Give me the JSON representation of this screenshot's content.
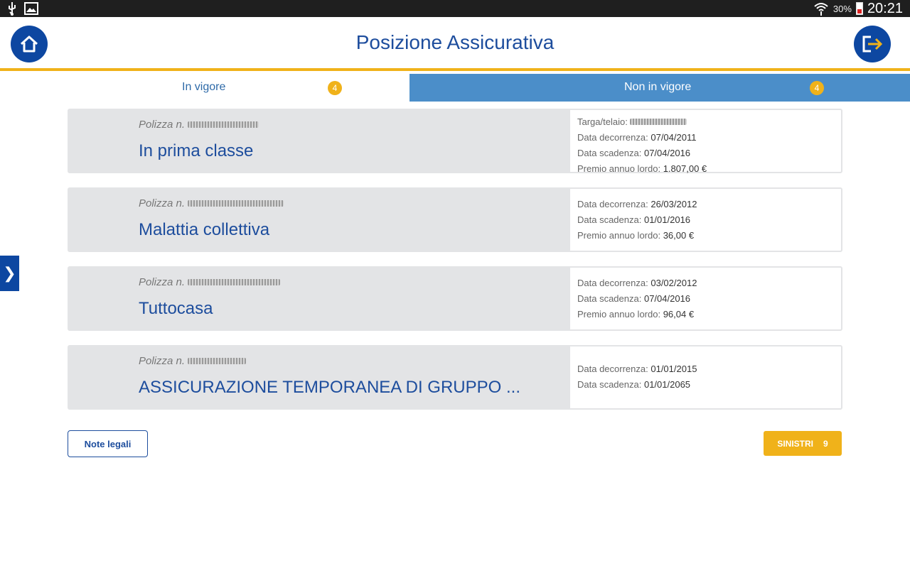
{
  "status_bar": {
    "battery_percent": "30%",
    "time": "20:21",
    "icons": [
      "usb-icon",
      "image-icon",
      "wifi-icon",
      "battery-icon"
    ]
  },
  "header": {
    "title": "Posizione Assicurativa",
    "home_icon": "home-icon",
    "logout_icon": "logout-icon"
  },
  "tabs": [
    {
      "label": "In vigore",
      "count": "4",
      "active": true
    },
    {
      "label": "Non in vigore",
      "count": "4",
      "active": false
    }
  ],
  "policies": [
    {
      "policy_label": "Polizza n.",
      "name": "In prima classe",
      "details": [
        {
          "label": "Targa/telaio:",
          "value": ""
        },
        {
          "label": "Data decorrenza:",
          "value": "07/04/2011"
        },
        {
          "label": "Data scadenza:",
          "value": "07/04/2016"
        },
        {
          "label": "Premio annuo lordo:",
          "value": "1.807,00 €"
        }
      ]
    },
    {
      "policy_label": "Polizza n.",
      "name": "Malattia collettiva",
      "details": [
        {
          "label": "Data decorrenza:",
          "value": "26/03/2012"
        },
        {
          "label": "Data scadenza:",
          "value": "01/01/2016"
        },
        {
          "label": "Premio annuo lordo:",
          "value": "36,00 €"
        }
      ]
    },
    {
      "policy_label": "Polizza n.",
      "name": "Tuttocasa",
      "details": [
        {
          "label": "Data decorrenza:",
          "value": "03/02/2012"
        },
        {
          "label": "Data scadenza:",
          "value": "07/04/2016"
        },
        {
          "label": "Premio annuo lordo:",
          "value": "96,04 €"
        }
      ]
    },
    {
      "policy_label": "Polizza n.",
      "name": "ASSICURAZIONE TEMPORANEA DI GRUPPO ...",
      "details": [
        {
          "label": "Data decorrenza:",
          "value": "01/01/2015"
        },
        {
          "label": "Data scadenza:",
          "value": "01/01/2065"
        }
      ]
    }
  ],
  "buttons": {
    "legal_label": "Note legali",
    "claims_label": "SINISTRI",
    "claims_count": "9"
  },
  "side_handle_icon": "chevron-right-icon",
  "colors": {
    "brand_blue": "#0d47a1",
    "title_blue": "#1d4d9d",
    "tab_blue": "#4b8ec9",
    "accent_yellow": "#f0b21a",
    "card_grey": "#e3e4e6"
  }
}
